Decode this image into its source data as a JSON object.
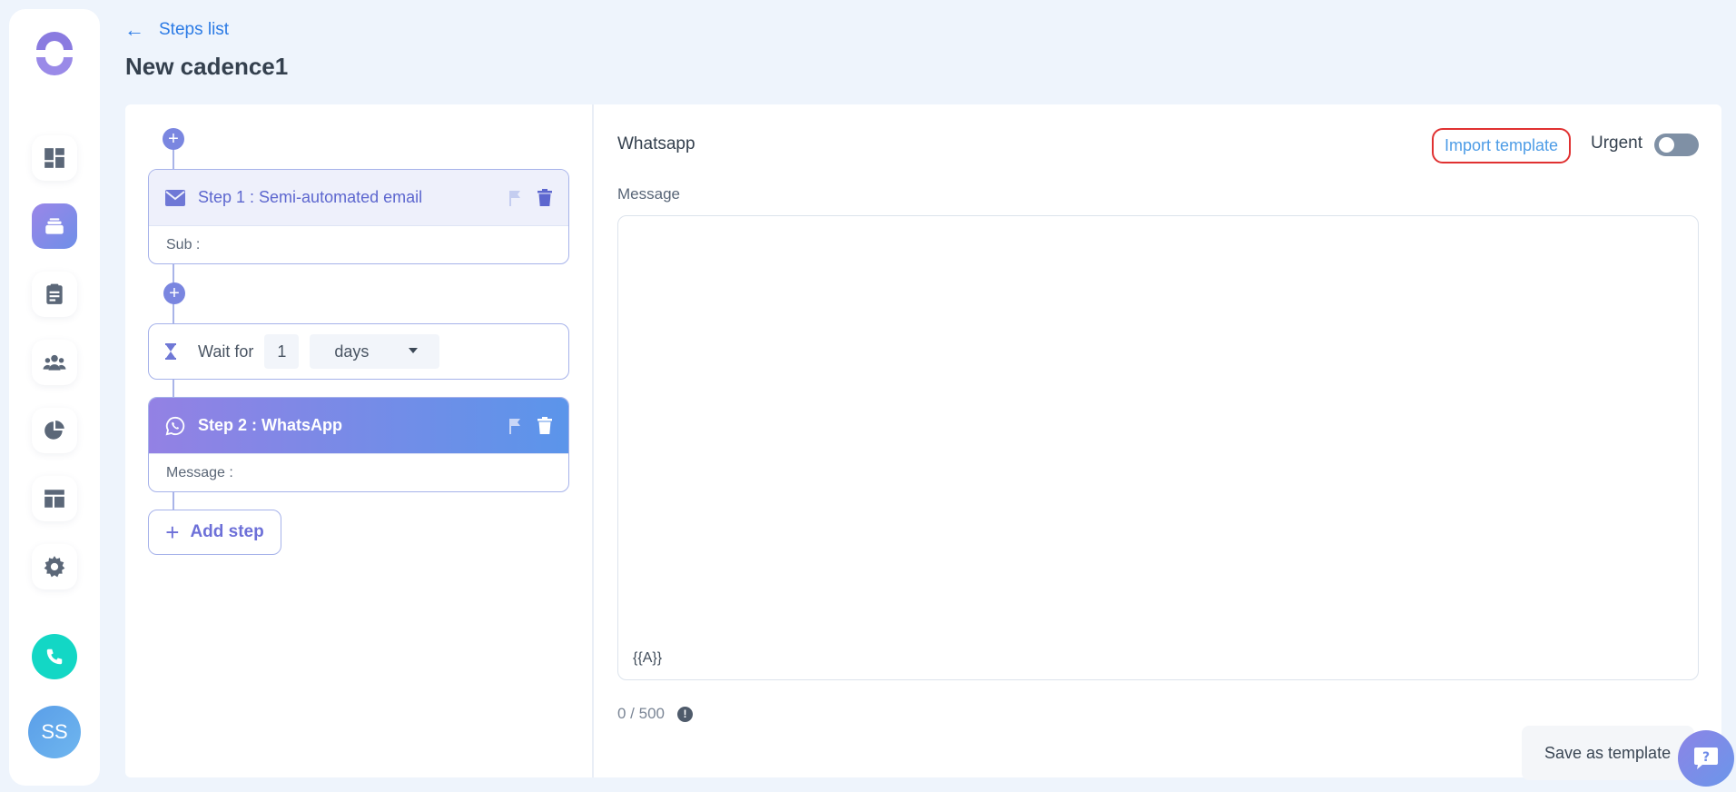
{
  "sidebar": {
    "logo": "brand-logo",
    "nav": [
      {
        "name": "dashboard",
        "icon": "dashboard-icon"
      },
      {
        "name": "cadences",
        "icon": "cadences-icon",
        "active": true
      },
      {
        "name": "tasks",
        "icon": "clipboard-icon"
      },
      {
        "name": "people",
        "icon": "people-icon"
      },
      {
        "name": "reports",
        "icon": "pie-chart-icon"
      },
      {
        "name": "templates",
        "icon": "layout-icon"
      },
      {
        "name": "settings",
        "icon": "gear-icon"
      }
    ],
    "phone_icon": "phone-icon",
    "avatar_initials": "SS"
  },
  "header": {
    "back_label": "Steps list",
    "title": "New cadence1"
  },
  "steps": [
    {
      "title": "Step 1 : Semi-automated email",
      "body": "Sub :",
      "icon": "envelope-icon"
    },
    {
      "title": "Step 2 : WhatsApp",
      "body": "Message :",
      "icon": "whatsapp-icon"
    }
  ],
  "wait": {
    "label": "Wait for",
    "value": "1",
    "unit": "days"
  },
  "add_step_label": "Add step",
  "panel": {
    "title": "Whatsapp",
    "import_label": "Import template",
    "urgent_label": "Urgent",
    "message_label": "Message",
    "message_variable": "{{A}}",
    "counter": "0 / 500",
    "save_template_label": "Save as template"
  },
  "colors": {
    "accent": "#6d70d8",
    "link": "#2c7be5",
    "highlight_border": "#e03131",
    "phone": "#13d7c5"
  }
}
